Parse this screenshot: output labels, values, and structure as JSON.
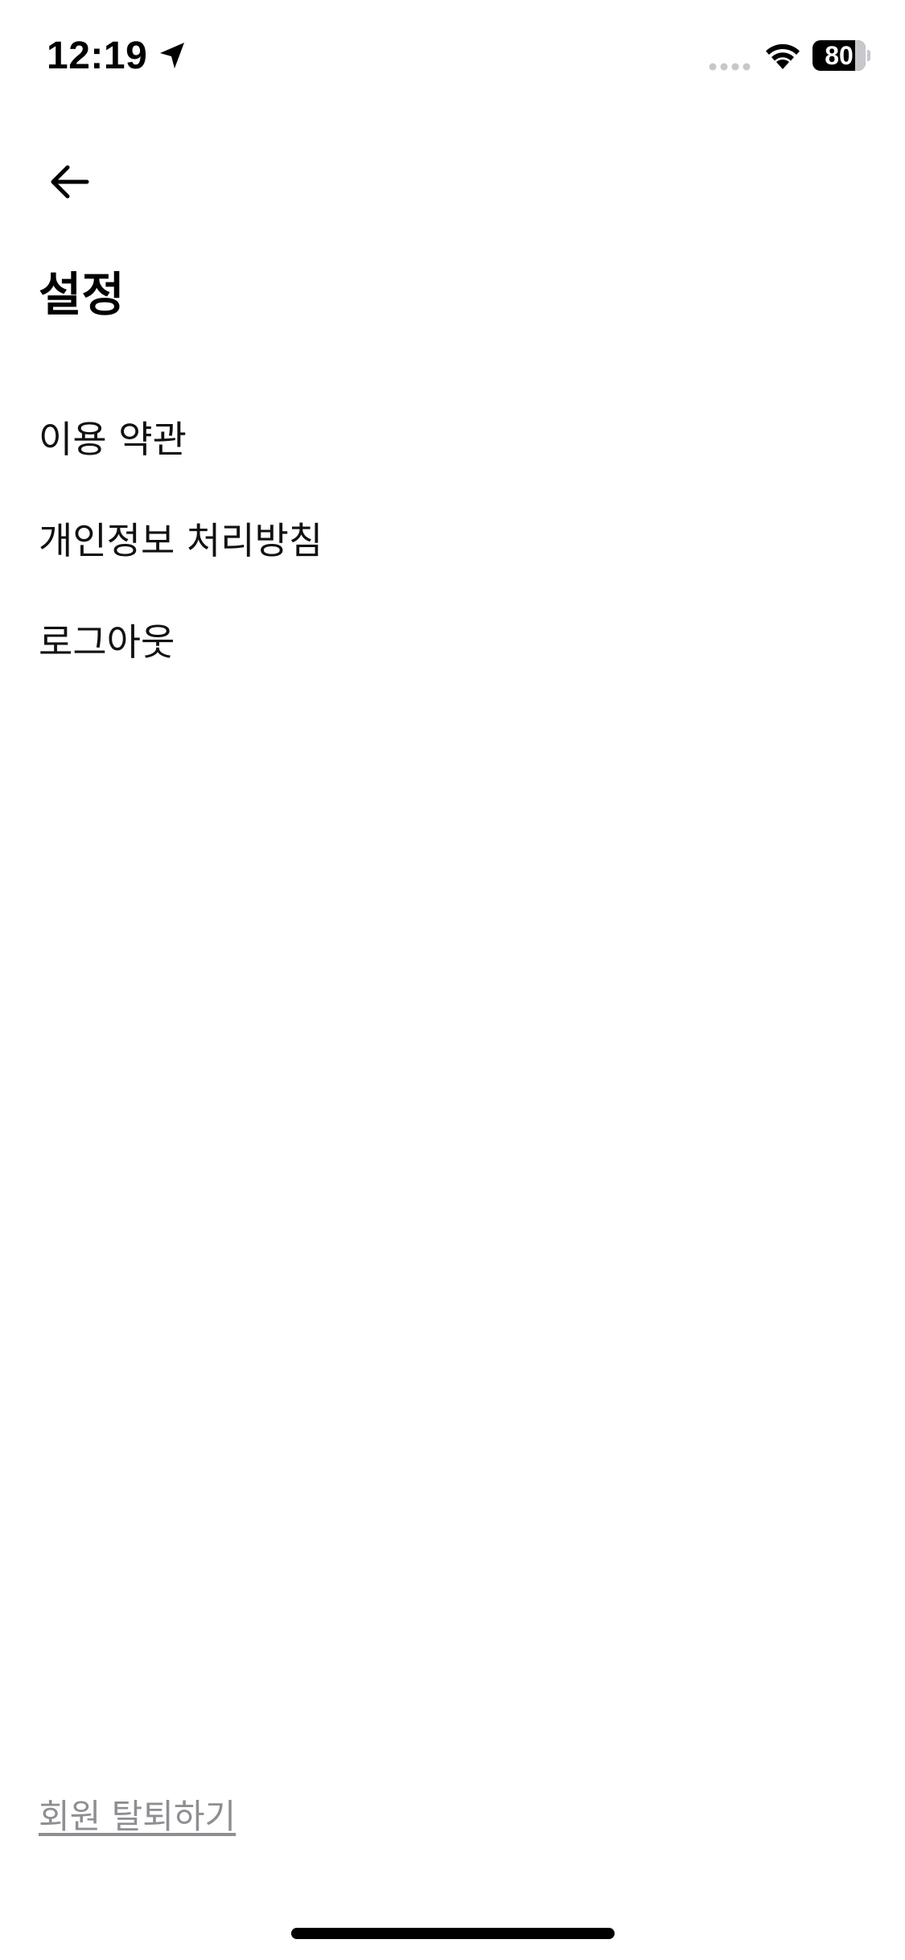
{
  "status_bar": {
    "time": "12:19",
    "battery_level": "80",
    "battery_fraction": 0.8,
    "icons": [
      "location-arrow-icon",
      "cellular-signal-icon",
      "wifi-icon",
      "battery-icon"
    ]
  },
  "header": {
    "back_icon": "arrow-left-icon",
    "title": "설정"
  },
  "menu": {
    "items": [
      {
        "label": "이용 약관"
      },
      {
        "label": "개인정보 처리방침"
      },
      {
        "label": "로그아웃"
      }
    ]
  },
  "footer": {
    "withdraw_label": "회원 탈퇴하기"
  },
  "colors": {
    "background": "#ffffff",
    "text_primary": "#000000",
    "text_secondary": "#8e8e93"
  }
}
